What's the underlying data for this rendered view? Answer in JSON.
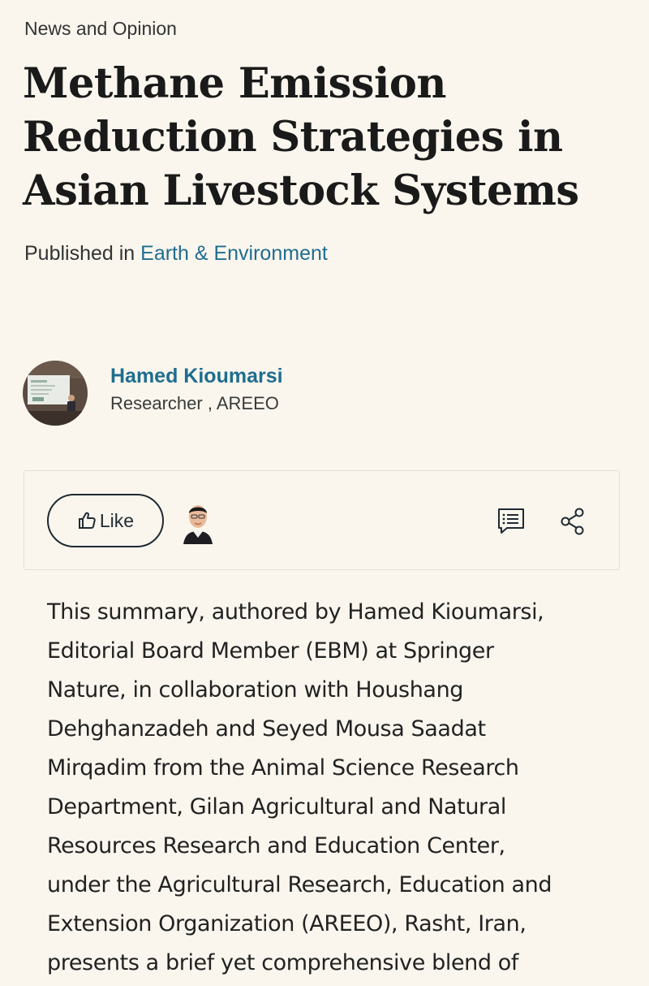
{
  "header": {
    "section": "News and Opinion",
    "title_lines": [
      "Methane Emission",
      "Reduction Strategies in",
      "Asian Livestock Systems"
    ],
    "published_prefix": "Published in ",
    "published_channel": "Earth & Environment"
  },
  "author": {
    "name": "Hamed Kioumarsi",
    "role": "Researcher , AREEO"
  },
  "actions": {
    "like_label": "Like",
    "like_icon": "thumbs-up-icon",
    "comment_icon": "comment-icon",
    "share_icon": "share-icon"
  },
  "body": {
    "lines": [
      "This summary, authored by Hamed Kioumarsi,",
      "Editorial Board Member (EBM) at Springer",
      "Nature, in collaboration with Houshang",
      "Dehghanzadeh and Seyed Mousa Saadat",
      "Mirqadim from the Animal Science Research",
      "Department, Gilan Agricultural and Natural",
      "Resources Research and Education Center,",
      "under the Agricultural Research, Education and",
      "Extension Organization (AREEO), Rasht, Iran,",
      "presents a brief yet comprehensive blend of"
    ]
  },
  "colors": {
    "background": "#faf6ee",
    "link": "#1f6d8f",
    "text": "#1c1c1c"
  }
}
